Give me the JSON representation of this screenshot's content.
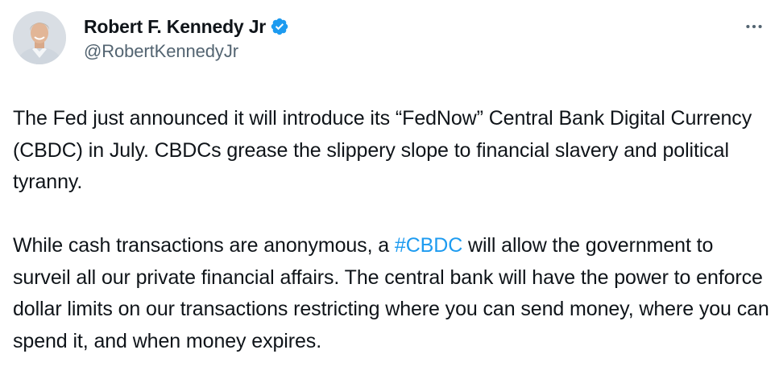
{
  "author": {
    "display_name": "Robert F. Kennedy Jr",
    "handle": "@RobertKennedyJr",
    "verified": true,
    "avatar_icon": "profile-photo",
    "verified_icon": "verified-badge-icon"
  },
  "menu": {
    "icon": "more-horizontal-icon"
  },
  "tweet": {
    "paragraph1": "The Fed just announced it will introduce its “FedNow” Central Bank Digital Currency (CBDC) in July. CBDCs grease the slippery slope to financial slavery and political tyranny.",
    "paragraph2_before": "While cash transactions are anonymous, a ",
    "hashtag": "#CBDC",
    "paragraph2_after": " will allow the government to surveil all our private financial affairs. The central bank will have the power to enforce dollar limits on our transactions restricting where you can send money, where you can spend it, and when money expires."
  },
  "colors": {
    "text": "#0f1419",
    "secondary_text": "#536471",
    "link": "#1d9bf0",
    "verified_badge": "#1d9bf0"
  }
}
